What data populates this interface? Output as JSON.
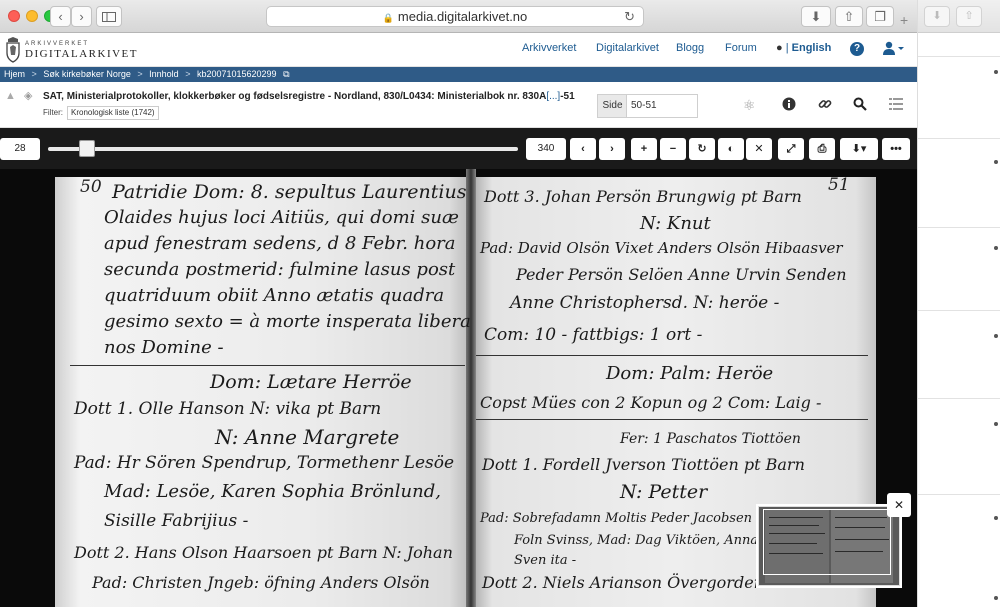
{
  "browser": {
    "url": "media.digitalarkivet.no"
  },
  "site": {
    "logo_small": "ARKIVVERKET",
    "logo_big": "DIGITALARKIVET",
    "nav": [
      "Arkivverket",
      "Digitalarkivet",
      "Blogg",
      "Forum"
    ],
    "language_sep": "|",
    "language": "English",
    "help_glyph": "?"
  },
  "breadcrumb": [
    "Hjem",
    "Søk kirkebøker Norge",
    "Innhold",
    "kb20071015620299"
  ],
  "breadcrumb_sep": ">",
  "record": {
    "title": "SAT, Ministerialprotokoller, klokkerbøker og fødselsregistre - Nordland, 830/L0434: Ministerialbok nr. 830A",
    "title_more": "[...]",
    "title_suffix": "-51",
    "filter_label": "Filter:",
    "filter_value": "Kronologisk liste (1742)",
    "side_label": "Side",
    "side_value": "50-51"
  },
  "viewer_toolbar": {
    "current": "28",
    "total": "340"
  },
  "manuscript": {
    "left_page_number": "50",
    "right_page_number": "51",
    "left_lines": [
      "Patridie Dom: 8. sepultus Laurentius",
      "Olaides hujus loci Aitiüs, qui domi suæ",
      "apud fenestram sedens, d 8 Febr. hora",
      "secunda postmerid: fulmine lasus post",
      "quatriduum obiit Anno ætatis quadra",
      "gesimo sexto = à morte insperata libera",
      "nos Domine -",
      "Dom: Lætare        Herröe",
      "Dott 1. Olle Hanson N: vika pt Barn",
      "N: Anne Margrete",
      "Pad: Hr Sören Spendrup, Tormethenr Lesöe",
      "Mad: Lesöe, Karen Sophia Brönlund,",
      "Sisille Fabrijius -",
      "Dott 2. Hans Olson Haarsoen pt Barn N: Johan",
      "Pad: Christen Jngeb: öfning Anders Olsön"
    ],
    "right_lines": [
      "Dott 3. Johan Persön Brungwig pt Barn",
      "N: Knut",
      "Pad: David Olsön Vixet Anders Olsön Hibaasver",
      "Peder Persön Selöen Anne Urvin Senden",
      "Anne Christophersd. N: heröe -",
      "Com: 10 - fattbigs: 1 ort -",
      "Dom: Palm:        Heröe",
      "Copst Mües con 2 Kopun og 2 Com: Laig -",
      "Fer: 1 Paschatos        Tiottöen",
      "Dott 1. Fordell Jverson Tiottöen pt Barn",
      "N: Petter",
      "Pad: Sobrefadamn Moltis Peder Jacobsen",
      "Foln Svinss, Mad: Dag Viktöen, Anna",
      "Sven ita -",
      "Dott 2. Niels Arianson Övergorden"
    ]
  }
}
